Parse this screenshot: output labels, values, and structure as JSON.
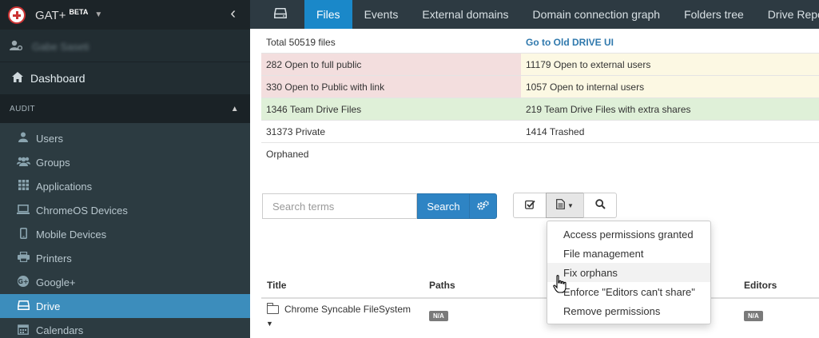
{
  "app": {
    "name": "GAT+",
    "badge": "BETA",
    "user_name": "Gabe Saseti"
  },
  "sidebar": {
    "dashboard": "Dashboard",
    "section": "AUDIT",
    "items": [
      {
        "label": "Users",
        "icon": "user-icon"
      },
      {
        "label": "Groups",
        "icon": "groups-icon"
      },
      {
        "label": "Applications",
        "icon": "grid-icon"
      },
      {
        "label": "ChromeOS Devices",
        "icon": "laptop-icon"
      },
      {
        "label": "Mobile Devices",
        "icon": "mobile-icon"
      },
      {
        "label": "Printers",
        "icon": "printer-icon"
      },
      {
        "label": "Google+",
        "icon": "google-plus-icon"
      },
      {
        "label": "Drive",
        "icon": "drive-icon",
        "active": true
      },
      {
        "label": "Calendars",
        "icon": "calendar-icon"
      }
    ]
  },
  "topnav": {
    "tabs": [
      "Files",
      "Events",
      "External domains",
      "Domain connection graph",
      "Folders tree",
      "Drive Report"
    ],
    "active": "Files"
  },
  "stats": {
    "total": "Total 50519 files",
    "old_ui_link": "Go to Old DRIVE UI",
    "open_public": "282 Open to full public",
    "open_external": "11179 Open to external users",
    "public_link": "330 Open to Public with link",
    "open_internal": "1057 Open to internal users",
    "team_drive": "1346 Team Drive Files",
    "team_drive_extra": "219 Team Drive Files with extra shares",
    "private": "31373 Private",
    "trashed": "1414 Trashed",
    "orphaned": "Orphaned"
  },
  "search": {
    "placeholder": "Search terms",
    "button": "Search"
  },
  "dropdown": {
    "items": [
      "Access permissions granted",
      "File management",
      "Fix orphans",
      "Enforce \"Editors can't share\"",
      "Remove permissions"
    ],
    "hovered": "Fix orphans"
  },
  "table": {
    "columns": [
      "Title",
      "Paths",
      "Editors"
    ],
    "rows": [
      {
        "title": "Chrome Syncable FileSystem",
        "paths": "N/A",
        "editors": "N/A"
      }
    ]
  },
  "colors": {
    "sidebar_bg": "#222d32",
    "active_blue": "#3c8dbc",
    "tab_active": "#1a88c9",
    "public_red": "#f3dede",
    "external_yellow": "#fcf8e3",
    "team_green": "#dff0d8"
  }
}
